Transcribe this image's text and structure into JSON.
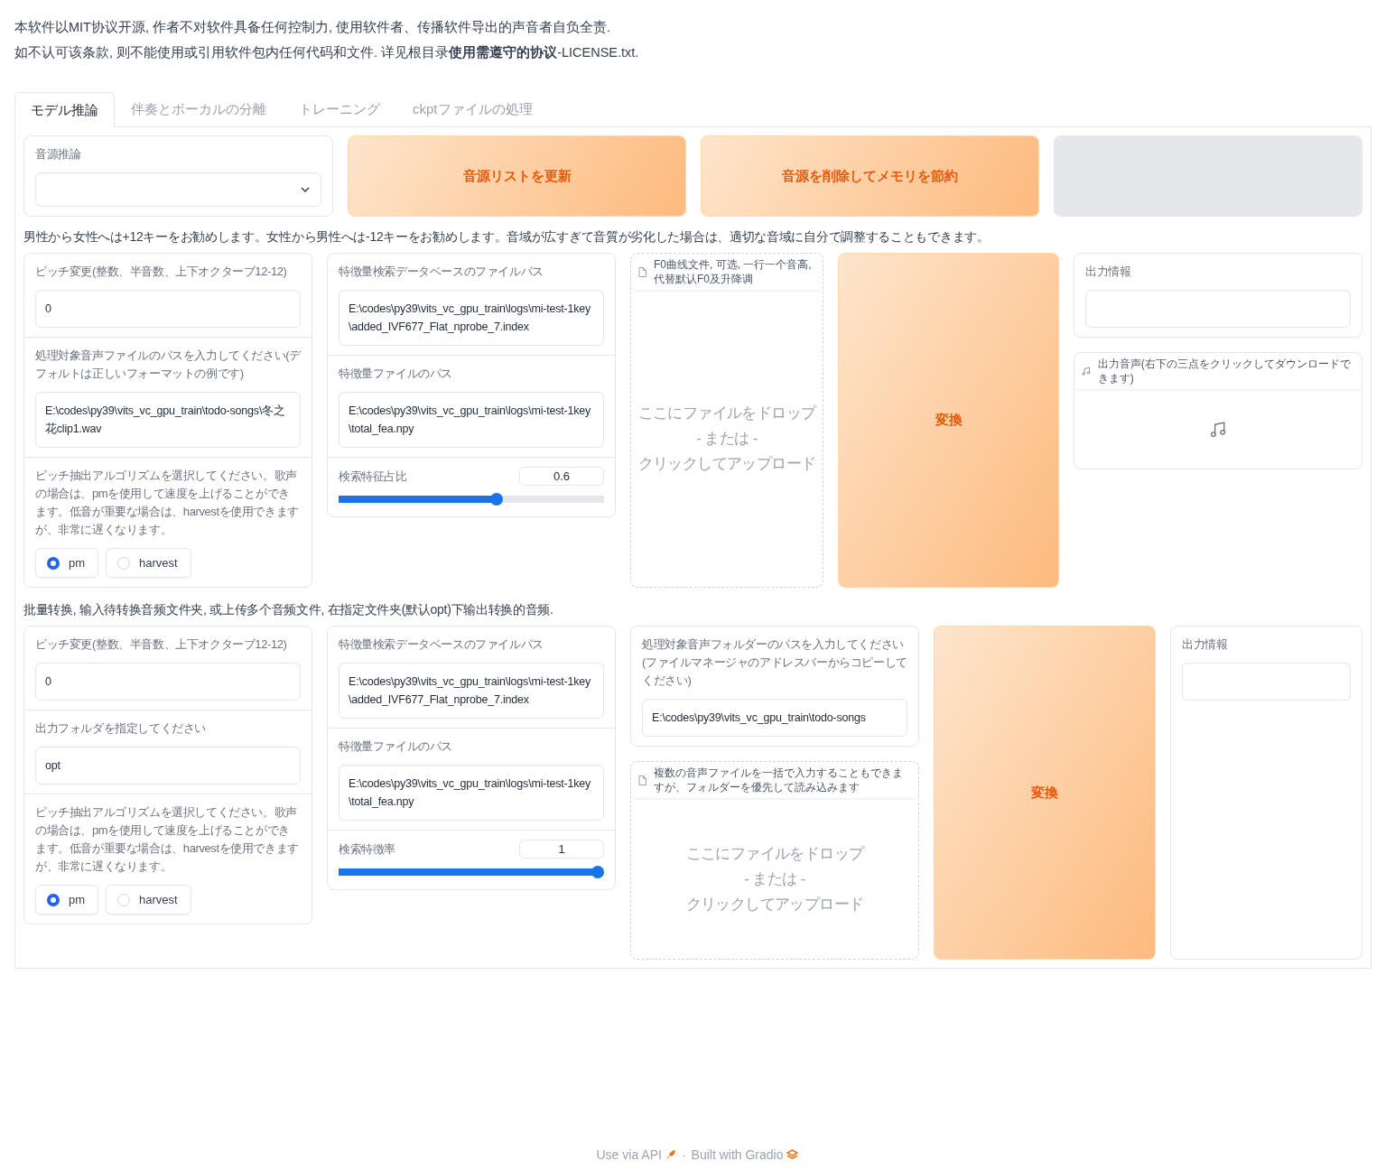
{
  "notice": [
    "本软件以MIT协议开源, 作者不对软件具备任何控制力, 使用软件者、传播软件导出的声音者自负全责.",
    "如不认可该条款, 则不能使用或引用软件包内任何代码和文件. 详见根目录**使用需遵守的协议**-LICENSE.txt."
  ],
  "tabs": [
    {
      "label": "モデル推論",
      "selected": true
    },
    {
      "label": "伴奏とボーカルの分離",
      "selected": false
    },
    {
      "label": "トレーニング",
      "selected": false
    },
    {
      "label": "ckptファイルの処理",
      "selected": false
    }
  ],
  "model_select": {
    "label": "音源推論"
  },
  "top_buttons": [
    "音源リストを更新",
    "音源を削除してメモリを節約"
  ],
  "single_hint": "男性から女性へは+12キーをお勧めします。女性から男性へは-12キーをお勧めします。音域が広すぎて音質が劣化した場合は、適切な音域に自分で調整することもできます。",
  "single": {
    "pitch": {
      "label": "ピッチ変更(整数、半音数、上下オクターブ12-12)",
      "value": "0"
    },
    "input": {
      "label": "処理対象音声ファイルのパスを入力してください(デフォルトは正しいフォーマットの例です)",
      "value": "E:\\codes\\py39\\vits_vc_gpu_train\\todo-songs\\冬之花clip1.wav"
    },
    "f0_method": {
      "label": "ピッチ抽出アルゴリズムを選択してください。歌声の場合は、pmを使用して速度を上げることができます。低音が重要な場合は、harvestを使用できますが、非常に遅くなります。",
      "options": [
        {
          "label": "pm",
          "selected": true
        },
        {
          "label": "harvest",
          "selected": false
        }
      ]
    },
    "index_path": {
      "label": "特徴量検索データベースのファイルパス",
      "value": "E:\\codes\\py39\\vits_vc_gpu_train\\logs\\mi-test-1key\\added_IVF677_Flat_nprobe_7.index"
    },
    "feature_path": {
      "label": "特徴量ファイルのパス",
      "value": "E:\\codes\\py39\\vits_vc_gpu_train\\logs\\mi-test-1key\\total_fea.npy"
    },
    "ratio": {
      "label": "検索特征占比",
      "value": "0.6",
      "level": 0.6
    },
    "upload": {
      "label": "F0曲线文件, 可选, 一行一个音高, 代替默认F0及升降调",
      "drop_text": [
        "ここにファイルをドロップ",
        "- または -",
        "クリックしてアップロード"
      ]
    },
    "convert_button": "変換",
    "output_info": {
      "label": "出力情報"
    },
    "output_audio": {
      "label": "出力音声(右下の三点をクリックしてダウンロードできます)"
    }
  },
  "batch_hint": "批量转换, 输入待转换音频文件夹, 或上传多个音频文件, 在指定文件夹(默认opt)下输出转换的音频.",
  "batch": {
    "pitch": {
      "label": "ピッチ変更(整数、半音数、上下オクターブ12-12)",
      "value": "0"
    },
    "output_folder": {
      "label": "出力フォルダを指定してください",
      "value": "opt"
    },
    "f0_method": {
      "label": "ピッチ抽出アルゴリズムを選択してください。歌声の場合は、pmを使用して速度を上げることができます。低音が重要な場合は、harvestを使用できますが、非常に遅くなります。",
      "options": [
        {
          "label": "pm",
          "selected": true
        },
        {
          "label": "harvest",
          "selected": false
        }
      ]
    },
    "index_path": {
      "label": "特徴量検索データベースのファイルパス",
      "value": "E:\\codes\\py39\\vits_vc_gpu_train\\logs\\mi-test-1key\\added_IVF677_Flat_nprobe_7.index"
    },
    "feature_path": {
      "label": "特徴量ファイルのパス",
      "value": "E:\\codes\\py39\\vits_vc_gpu_train\\logs\\mi-test-1key\\total_fea.npy"
    },
    "ratio": {
      "label": "検索特徴率",
      "value": "1",
      "level": 1
    },
    "input_folder": {
      "label": "処理対象音声フォルダーのパスを入力してください(ファイルマネージャのアドレスバーからコピーしてください)",
      "value": "E:\\codes\\py39\\vits_vc_gpu_train\\todo-songs"
    },
    "upload": {
      "label": "複数の音声ファイルを一括で入力することもできますが、フォルダーを優先して読み込みます",
      "drop_text": [
        "ここにファイルをドロップ",
        "- または -",
        "クリックしてアップロード"
      ]
    },
    "convert_button": "変換",
    "output_info": {
      "label": "出力情報"
    }
  },
  "footer": {
    "api_link": "Use via API",
    "separator": "·",
    "built_with": "Built with Gradio"
  }
}
